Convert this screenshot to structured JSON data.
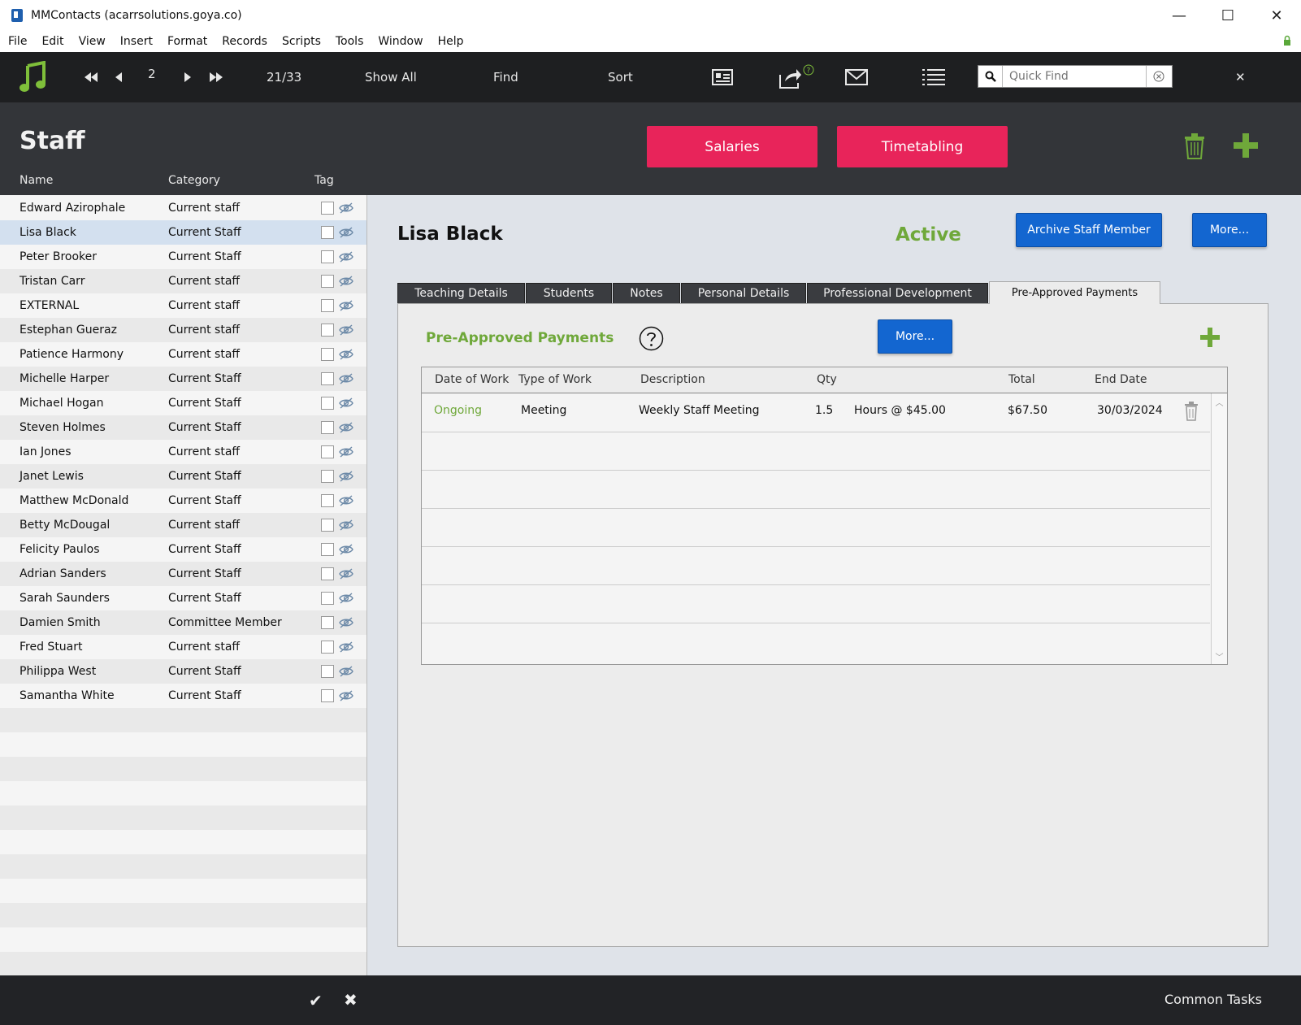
{
  "window": {
    "title": "MMContacts (acarrsolutions.goya.co)",
    "minimize": "—",
    "maximize": "☐",
    "close": "✕"
  },
  "menu": [
    "File",
    "Edit",
    "View",
    "Insert",
    "Format",
    "Records",
    "Scripts",
    "Tools",
    "Window",
    "Help"
  ],
  "toolbar": {
    "page_number": "2",
    "record_count": "21/33",
    "show_all": "Show All",
    "find": "Find",
    "sort": "Sort",
    "quick_find_placeholder": "Quick Find",
    "close": "✕"
  },
  "header": {
    "title": "Staff",
    "salaries": "Salaries",
    "timetabling": "Timetabling",
    "columns": {
      "name": "Name",
      "category": "Category",
      "tag": "Tag"
    }
  },
  "staff": [
    {
      "name": "Edward Azirophale",
      "category": "Current staff"
    },
    {
      "name": "Lisa Black",
      "category": "Current Staff",
      "selected": true
    },
    {
      "name": "Peter Brooker",
      "category": "Current Staff"
    },
    {
      "name": "Tristan Carr",
      "category": "Current staff"
    },
    {
      "name": " EXTERNAL",
      "category": "Current staff"
    },
    {
      "name": "Estephan Gueraz",
      "category": "Current staff"
    },
    {
      "name": "Patience Harmony",
      "category": "Current staff"
    },
    {
      "name": "Michelle Harper",
      "category": "Current Staff"
    },
    {
      "name": "Michael Hogan",
      "category": "Current Staff"
    },
    {
      "name": "Steven Holmes",
      "category": "Current Staff"
    },
    {
      "name": "Ian Jones",
      "category": "Current staff"
    },
    {
      "name": "Janet Lewis",
      "category": "Current Staff"
    },
    {
      "name": "Matthew McDonald",
      "category": "Current Staff"
    },
    {
      "name": "Betty McDougal",
      "category": "Current staff"
    },
    {
      "name": "Felicity Paulos",
      "category": "Current Staff"
    },
    {
      "name": "Adrian Sanders",
      "category": "Current Staff"
    },
    {
      "name": "Sarah Saunders",
      "category": "Current Staff"
    },
    {
      "name": "Damien Smith",
      "category": "Committee Member"
    },
    {
      "name": "Fred Stuart",
      "category": "Current staff"
    },
    {
      "name": "Philippa West",
      "category": "Current Staff"
    },
    {
      "name": "Samantha White",
      "category": "Current Staff"
    }
  ],
  "record": {
    "name": "Lisa Black",
    "status": "Active",
    "archive_button": "Archive Staff Member",
    "more_button": "More..."
  },
  "tabs": [
    "Teaching Details",
    "Students",
    "Notes",
    "Personal Details",
    "Professional Development",
    "Pre-Approved Payments"
  ],
  "active_tab": "Pre-Approved Payments",
  "payments": {
    "title": "Pre-Approved Payments",
    "more_button": "More...",
    "columns": [
      "Date of Work",
      "Type of Work",
      "Description",
      "Qty",
      "Total",
      "End Date"
    ],
    "rows": [
      {
        "date_of_work": "Ongoing",
        "type_of_work": "Meeting",
        "description": "Weekly Staff Meeting",
        "qty": "1.5",
        "rate": "Hours @ $45.00",
        "total": "$67.50",
        "end_date": "30/03/2024"
      }
    ]
  },
  "footer": {
    "common_tasks": "Common Tasks"
  },
  "colors": {
    "accent_pink": "#e8245a",
    "accent_blue": "#1366d0",
    "accent_green": "#6fa83a",
    "toolbar_bg": "#1e1f21",
    "header_bg": "#333539"
  }
}
